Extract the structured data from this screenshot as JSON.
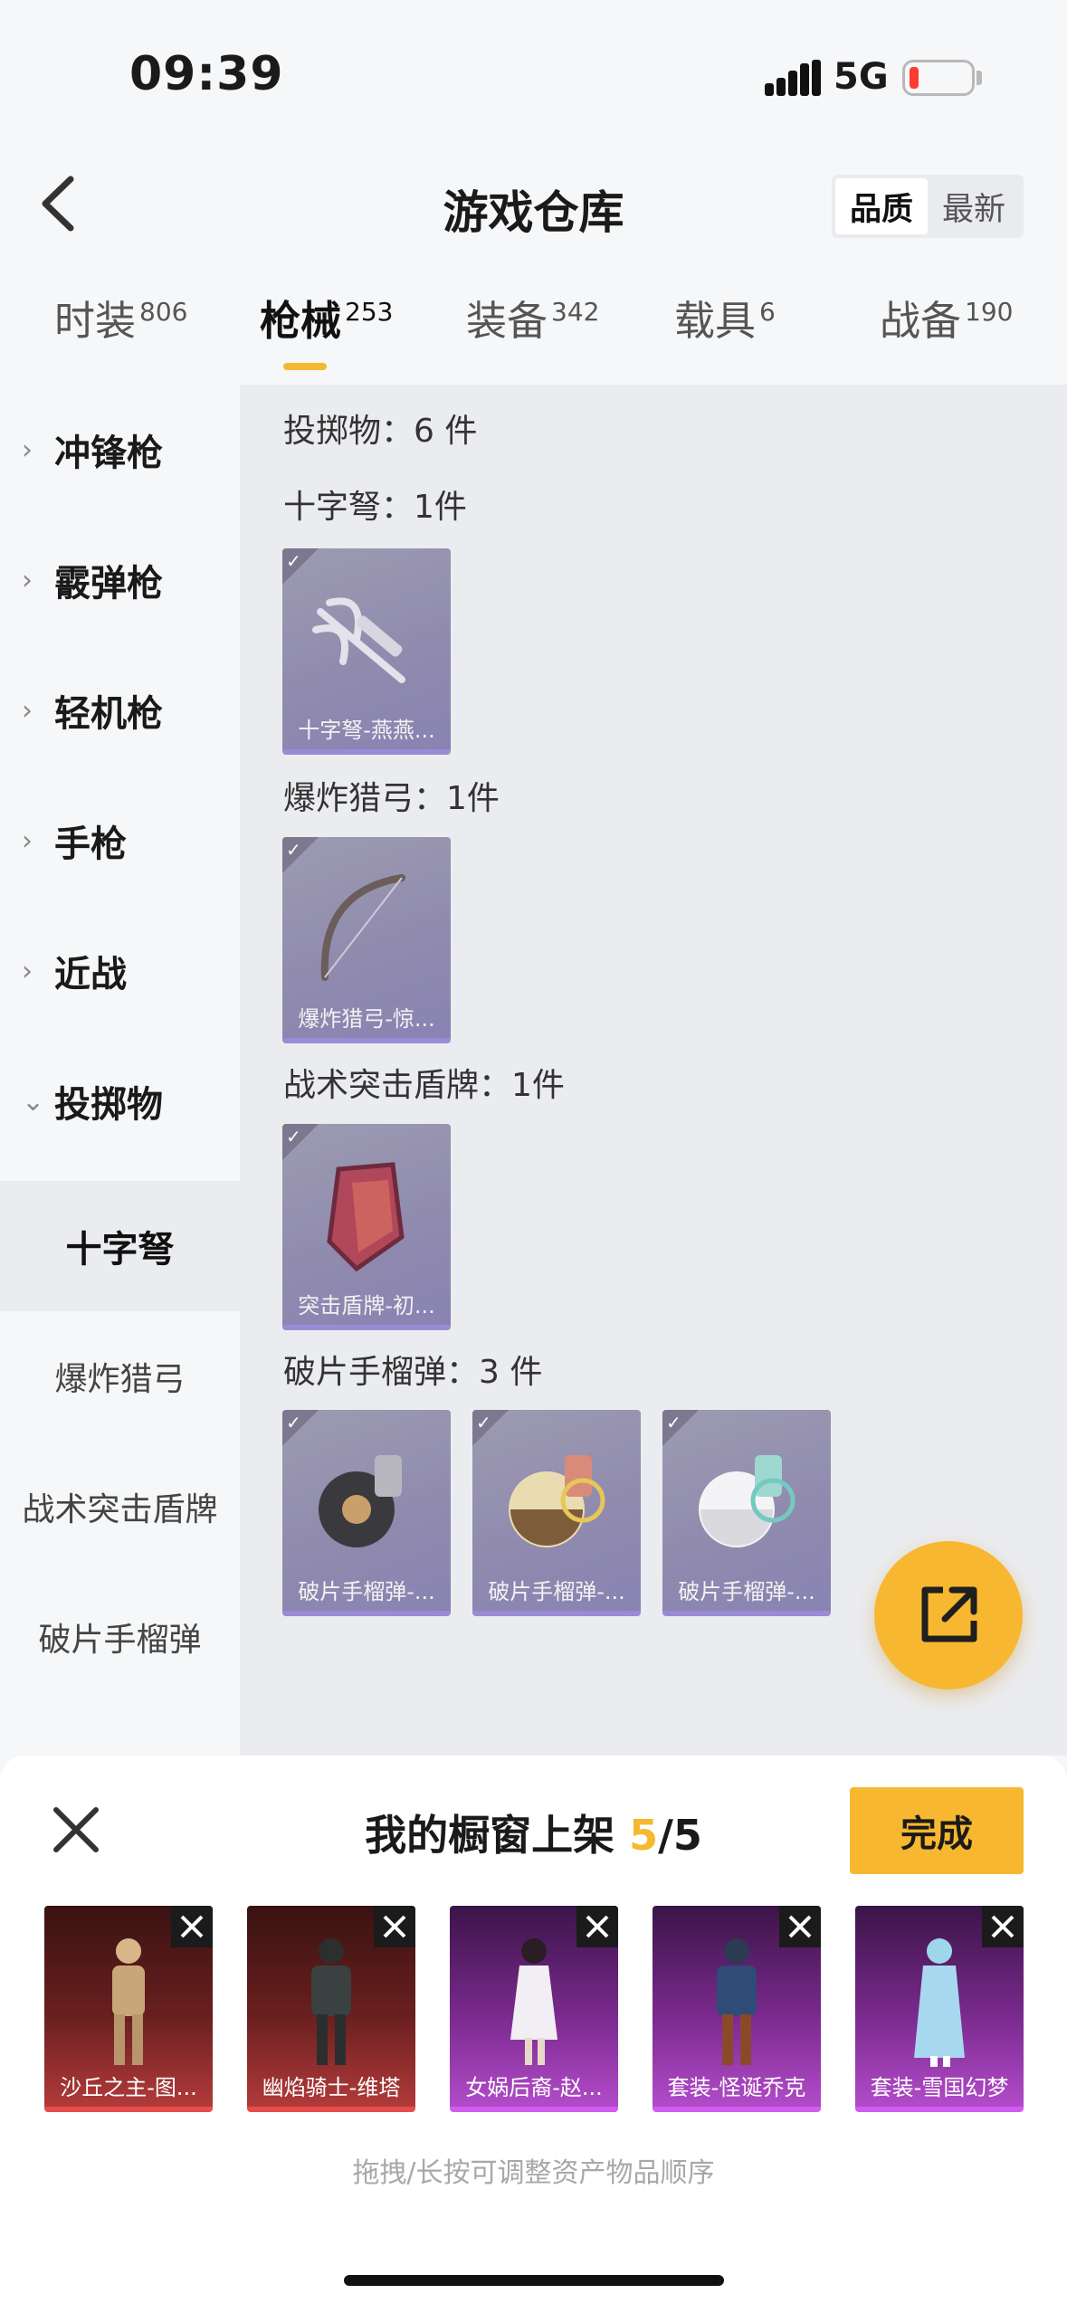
{
  "status": {
    "time": "09:39",
    "network": "5G"
  },
  "header": {
    "title": "游戏仓库",
    "sort": [
      "品质",
      "最新"
    ]
  },
  "tabs": [
    {
      "label": "时装",
      "count": "806"
    },
    {
      "label": "枪械",
      "count": "253"
    },
    {
      "label": "装备",
      "count": "342"
    },
    {
      "label": "载具",
      "count": "6"
    },
    {
      "label": "战备",
      "count": "190"
    }
  ],
  "sidebar": {
    "categories": [
      "冲锋枪",
      "霰弹枪",
      "轻机枪",
      "手枪",
      "近战",
      "投掷物"
    ],
    "subcategories": [
      "十字弩",
      "爆炸猎弓",
      "战术突击盾牌",
      "破片手榴弹"
    ]
  },
  "content": {
    "summary": "投掷物：6 件",
    "sections": [
      {
        "title": "十字弩：1件",
        "items": [
          "十字弩-燕燕..."
        ]
      },
      {
        "title": "爆炸猎弓：1件",
        "items": [
          "爆炸猎弓-惊..."
        ]
      },
      {
        "title": "战术突击盾牌：1件",
        "items": [
          "突击盾牌-初..."
        ]
      },
      {
        "title": "破片手榴弹：3 件",
        "items": [
          "破片手榴弹-...",
          "破片手榴弹-...",
          "破片手榴弹-..."
        ]
      }
    ]
  },
  "shelf": {
    "title": "我的橱窗上架",
    "count": "5",
    "total": "/5",
    "done_label": "完成",
    "items": [
      "沙丘之主-图...",
      "幽焰骑士-维塔",
      "女娲后裔-赵...",
      "套装-怪诞乔克",
      "套装-雪国幻梦"
    ],
    "hint": "拖拽/长按可调整资产物品顺序"
  },
  "colors": {
    "accent": "#f7b730",
    "legendary": "#e74c4c",
    "epic": "#d15cf0",
    "rare": "#9b8ad6"
  }
}
